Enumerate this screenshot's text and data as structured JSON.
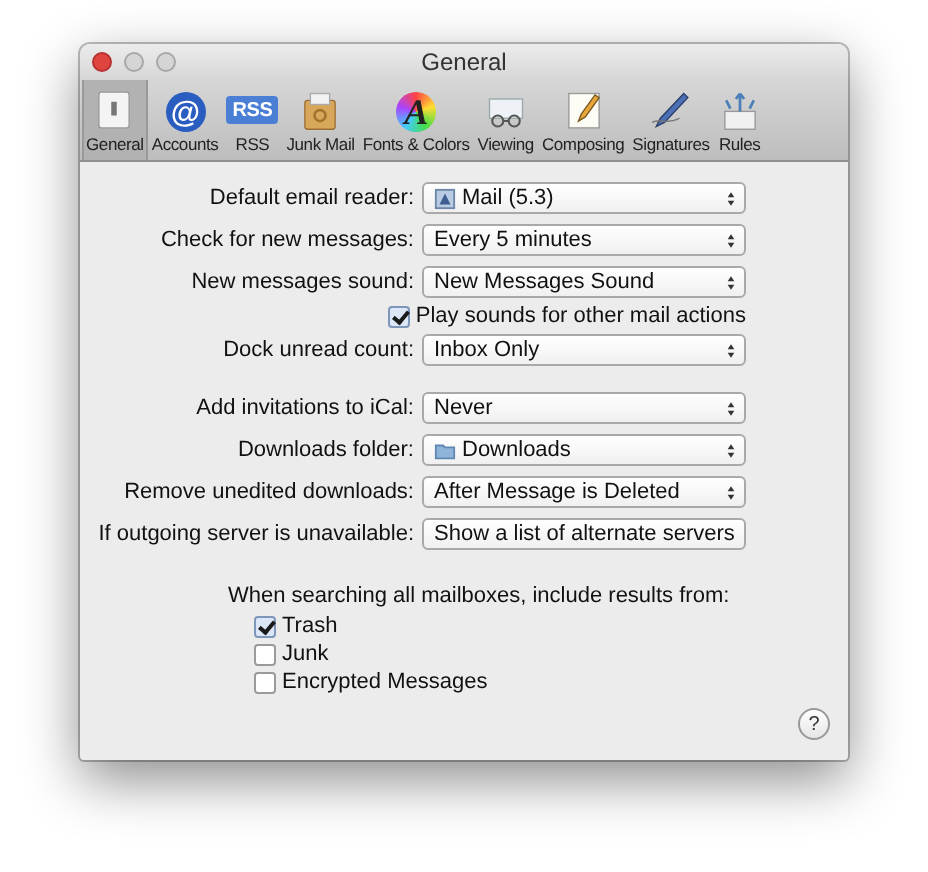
{
  "window": {
    "title": "General"
  },
  "toolbar": [
    {
      "kind": "general",
      "label": "General",
      "selected": true
    },
    {
      "kind": "accounts",
      "label": "Accounts",
      "selected": false,
      "glyph": "@"
    },
    {
      "kind": "rss",
      "label": "RSS",
      "selected": false,
      "glyph": "RSS"
    },
    {
      "kind": "junk",
      "label": "Junk Mail",
      "selected": false
    },
    {
      "kind": "fonts",
      "label": "Fonts & Colors",
      "selected": false,
      "glyph": "A"
    },
    {
      "kind": "viewing",
      "label": "Viewing",
      "selected": false
    },
    {
      "kind": "composing",
      "label": "Composing",
      "selected": false
    },
    {
      "kind": "signatures",
      "label": "Signatures",
      "selected": false
    },
    {
      "kind": "rules",
      "label": "Rules",
      "selected": false
    }
  ],
  "groups": [
    [
      {
        "kind": "app_popup",
        "label": "Default email reader:",
        "value": "Mail (5.3)"
      },
      {
        "kind": "popup",
        "label": "Check for new messages:",
        "value": "Every 5 minutes"
      },
      {
        "kind": "popup",
        "label": "New messages sound:",
        "value": "New Messages Sound"
      },
      {
        "kind": "checkbox",
        "label": "Play sounds for other mail actions",
        "checked": true
      },
      {
        "kind": "popup",
        "label": "Dock unread count:",
        "value": "Inbox Only"
      }
    ],
    [
      {
        "kind": "popup",
        "label": "Add invitations to iCal:",
        "value": "Never"
      },
      {
        "kind": "folder_popup",
        "label": "Downloads folder:",
        "value": "Downloads"
      },
      {
        "kind": "popup",
        "label": "Remove unedited downloads:",
        "value": "After Message is Deleted"
      },
      {
        "kind": "popup",
        "label": "If outgoing server is unavailable:",
        "value": "Show a list of alternate servers"
      }
    ]
  ],
  "search": {
    "heading": "When searching all mailboxes, include results from:",
    "options": [
      {
        "label": "Trash",
        "checked": true
      },
      {
        "label": "Junk",
        "checked": false
      },
      {
        "label": "Encrypted Messages",
        "checked": false
      }
    ]
  },
  "help": {
    "label": "?"
  }
}
